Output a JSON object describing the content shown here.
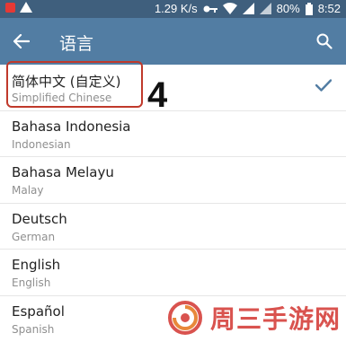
{
  "status_bar": {
    "speed": "1.29 K/s",
    "battery": "80%",
    "time": "8:52"
  },
  "app_bar": {
    "title": "语言",
    "back_icon": "arrow-left-icon",
    "search_icon": "search-icon"
  },
  "annotation": {
    "step": "4"
  },
  "languages": [
    {
      "name": "简体中文 (自定义)",
      "sub": "Simplified Chinese",
      "selected": true
    },
    {
      "name": "Bahasa Indonesia",
      "sub": "Indonesian",
      "selected": false
    },
    {
      "name": "Bahasa Melayu",
      "sub": "Malay",
      "selected": false
    },
    {
      "name": "Deutsch",
      "sub": "German",
      "selected": false
    },
    {
      "name": "English",
      "sub": "English",
      "selected": false
    },
    {
      "name": "Español",
      "sub": "Spanish",
      "selected": false
    }
  ],
  "watermark": {
    "text": "周三手游网"
  },
  "colors": {
    "app_bar": "#527da3",
    "status_bar": "#3f5f7d",
    "check": "#527da3",
    "highlight": "#c0392b"
  }
}
